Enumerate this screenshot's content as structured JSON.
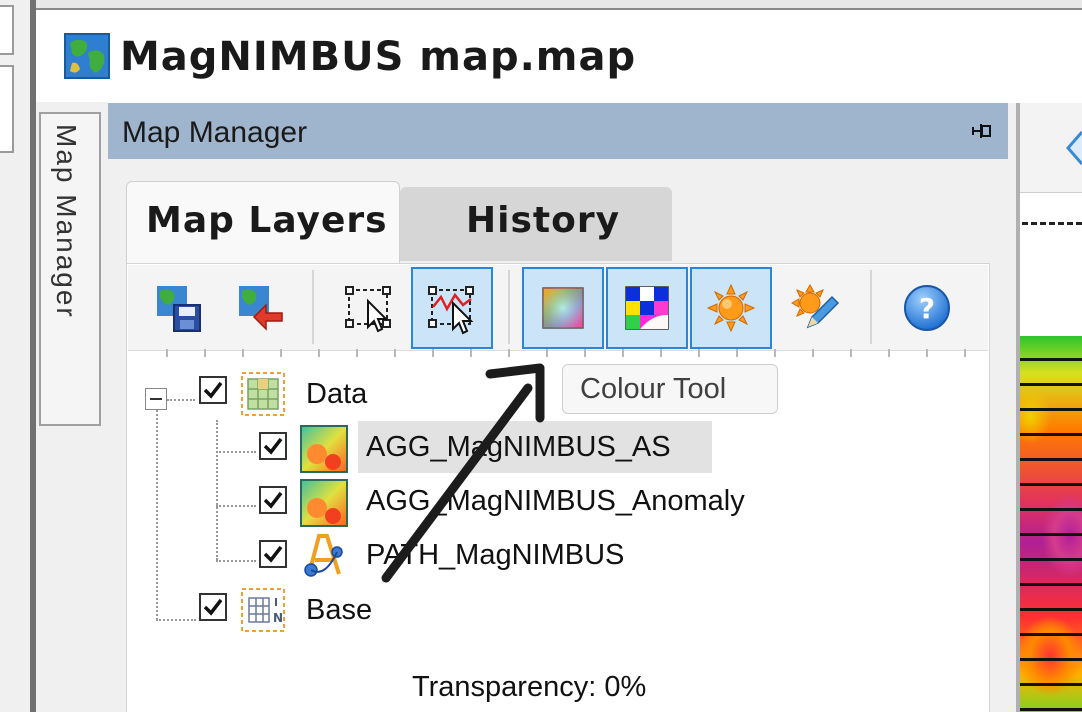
{
  "window": {
    "title": "MagNIMBUS map.map"
  },
  "side_tab": {
    "label": "Map Manager"
  },
  "panel": {
    "title": "Map Manager"
  },
  "tabs": [
    {
      "label": "Map Layers",
      "active": true
    },
    {
      "label": "History",
      "active": false
    }
  ],
  "toolbar": {
    "buttons": [
      {
        "name": "save-map-icon",
        "active": false
      },
      {
        "name": "import-map-icon",
        "active": false
      },
      {
        "name": "select-region-icon",
        "active": false
      },
      {
        "name": "profile-select-icon",
        "active": true
      },
      {
        "name": "colour-tool-icon",
        "active": true
      },
      {
        "name": "colour-palette-icon",
        "active": true
      },
      {
        "name": "sun-shading-icon",
        "active": true
      },
      {
        "name": "sun-edit-icon",
        "active": false
      },
      {
        "name": "help-icon",
        "active": false
      }
    ]
  },
  "tooltip": {
    "text": "Colour Tool"
  },
  "tree": {
    "groups": [
      {
        "label": "Data",
        "checked": true,
        "expanded": true,
        "children": [
          {
            "label": "AGG_MagNIMBUS_AS",
            "checked": true,
            "selected": true,
            "icon": "grid-layer-icon"
          },
          {
            "label": "AGG_MagNIMBUS_Anomaly",
            "checked": true,
            "selected": false,
            "icon": "grid-layer-icon"
          },
          {
            "label": "PATH_MagNIMBUS",
            "checked": true,
            "selected": false,
            "icon": "path-layer-icon"
          }
        ]
      },
      {
        "label": "Base",
        "checked": true,
        "expanded": false,
        "children": []
      }
    ]
  },
  "transparency": {
    "label": "Transparency: 0%",
    "value_percent": 0
  },
  "colors": {
    "panel_header": "#9fb4cd",
    "active_button_border": "#2a86d8",
    "active_button_fill": "#cce4f7"
  }
}
